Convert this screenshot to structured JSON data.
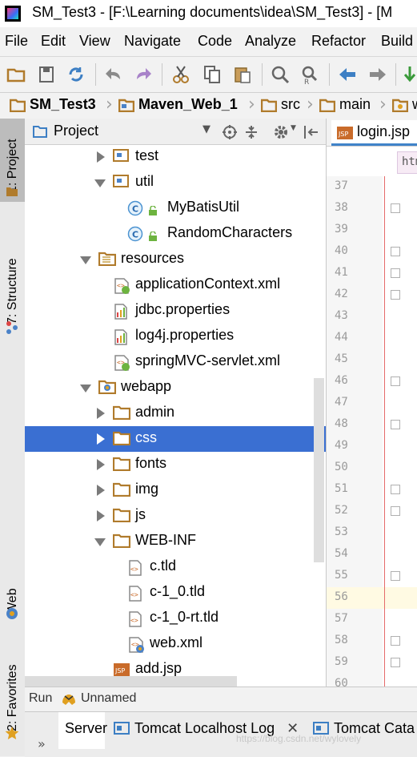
{
  "window": {
    "title": "SM_Test3 - [F:\\Learning documents\\idea\\SM_Test3] - [M"
  },
  "menu": [
    "File",
    "Edit",
    "View",
    "Navigate",
    "Code",
    "Analyze",
    "Refactor",
    "Build"
  ],
  "breadcrumb": [
    "SM_Test3",
    "Maven_Web_1",
    "src",
    "main",
    "w"
  ],
  "left_strip": {
    "project": "1: Project",
    "structure": "7: Structure",
    "web": "Web",
    "favorites": "2: Favorites"
  },
  "project_panel": {
    "title": "Project"
  },
  "tree": [
    {
      "label": "test",
      "icon": "source-folder-icon",
      "expander": "collapsed"
    },
    {
      "label": "util",
      "icon": "source-folder-icon",
      "expander": "expanded"
    },
    {
      "label": "MyBatisUtil",
      "icon": "class-icon",
      "expander": "none"
    },
    {
      "label": "RandomCharacters",
      "icon": "class-icon",
      "expander": "none"
    },
    {
      "label": "resources",
      "icon": "resources-folder-icon",
      "expander": "expanded"
    },
    {
      "label": "applicationContext.xml",
      "icon": "spring-xml-icon",
      "expander": "none"
    },
    {
      "label": "jdbc.properties",
      "icon": "properties-icon",
      "expander": "none"
    },
    {
      "label": "log4j.properties",
      "icon": "properties-icon",
      "expander": "none"
    },
    {
      "label": "springMVC-servlet.xml",
      "icon": "spring-xml-icon",
      "expander": "none"
    },
    {
      "label": "webapp",
      "icon": "web-folder-icon",
      "expander": "expanded"
    },
    {
      "label": "admin",
      "icon": "folder-icon",
      "expander": "collapsed"
    },
    {
      "label": "css",
      "icon": "folder-icon",
      "expander": "collapsed",
      "selected": true
    },
    {
      "label": "fonts",
      "icon": "folder-icon",
      "expander": "collapsed"
    },
    {
      "label": "img",
      "icon": "folder-icon",
      "expander": "collapsed"
    },
    {
      "label": "js",
      "icon": "folder-icon",
      "expander": "collapsed"
    },
    {
      "label": "WEB-INF",
      "icon": "folder-icon",
      "expander": "expanded"
    },
    {
      "label": "c.tld",
      "icon": "tld-icon",
      "expander": "none"
    },
    {
      "label": "c-1_0.tld",
      "icon": "tld-icon",
      "expander": "none"
    },
    {
      "label": "c-1_0-rt.tld",
      "icon": "tld-icon",
      "expander": "none"
    },
    {
      "label": "web.xml",
      "icon": "web-xml-icon",
      "expander": "none"
    },
    {
      "label": "add.jsp",
      "icon": "jsp-icon",
      "expander": "none"
    }
  ],
  "editor": {
    "tab_label": "login.jsp",
    "breadcrumb_tag": "htm",
    "line_numbers": [
      "37",
      "38",
      "39",
      "40",
      "41",
      "42",
      "43",
      "44",
      "45",
      "46",
      "47",
      "48",
      "49",
      "50",
      "51",
      "52",
      "53",
      "54",
      "55",
      "56",
      "57",
      "58",
      "59",
      "60"
    ],
    "current_line": "56"
  },
  "run_bar": {
    "label": "Run",
    "config": "Unnamed"
  },
  "bottom_tabs": [
    "Server",
    "Tomcat Localhost Log",
    "Tomcat Cata"
  ],
  "bottom_more": "»",
  "watermark": "https://blog.csdn.net/wylovely",
  "colors": {
    "selection": "#3a6fd2",
    "folder": "#b07b2c",
    "accent": "#4083c9"
  }
}
